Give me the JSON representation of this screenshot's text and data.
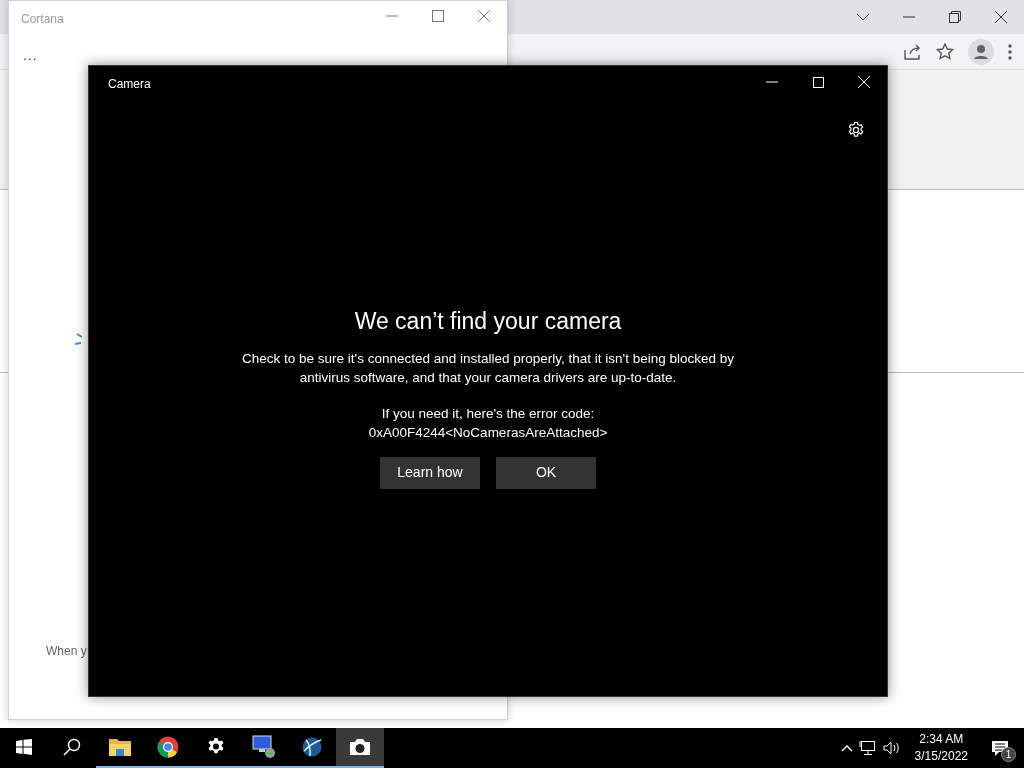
{
  "cortana": {
    "title": "Cortana",
    "more": "...",
    "footer": "When y"
  },
  "camera": {
    "title": "Camera",
    "heading": "We can’t find your camera",
    "message": "Check to be sure it's connected and installed properly, that it isn't being blocked by antivirus software, and that your camera drivers are up-to-date.",
    "error_label": "If you need it, here's the error code:",
    "error_code": "0xA00F4244<NoCamerasAreAttached>",
    "buttons": [
      "Learn how",
      "OK"
    ]
  },
  "taskbar": {
    "apps": [
      {
        "kind": "start",
        "running": false,
        "selected": false
      },
      {
        "kind": "search",
        "running": false,
        "selected": false
      },
      {
        "kind": "folder",
        "running": true,
        "selected": false
      },
      {
        "kind": "browser",
        "running": true,
        "selected": false
      },
      {
        "kind": "gear",
        "running": true,
        "selected": false
      },
      {
        "kind": "monitor",
        "running": true,
        "selected": false
      },
      {
        "kind": "globe",
        "running": true,
        "selected": false
      },
      {
        "kind": "camera",
        "running": true,
        "selected": true
      }
    ],
    "time": "2:34 AM",
    "date": "3/15/2022",
    "notifications": "1"
  }
}
